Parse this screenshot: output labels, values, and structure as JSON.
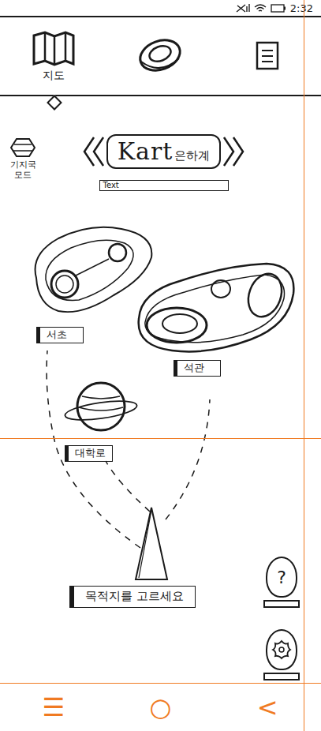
{
  "status_bar": {
    "time": "2:32"
  },
  "tabs": [
    {
      "label": "지도",
      "kind": "map",
      "selected": true
    },
    {
      "kind": "coin",
      "selected": false
    },
    {
      "kind": "document",
      "selected": false
    }
  ],
  "mode_button": {
    "label": "기지국 모드"
  },
  "title": {
    "logo": "Kart",
    "suffix": "은하계",
    "subtitle": "Text"
  },
  "destinations": [
    {
      "name": "서초",
      "kind": "nebula"
    },
    {
      "name": "석관",
      "kind": "asteroid"
    },
    {
      "name": "대학로",
      "kind": "ringed"
    }
  ],
  "prompt": "목적지를 고르세요",
  "side_buttons": [
    {
      "kind": "help",
      "label": "?"
    },
    {
      "kind": "settings"
    }
  ],
  "nav_bar": [
    "☰",
    "○",
    "<"
  ]
}
